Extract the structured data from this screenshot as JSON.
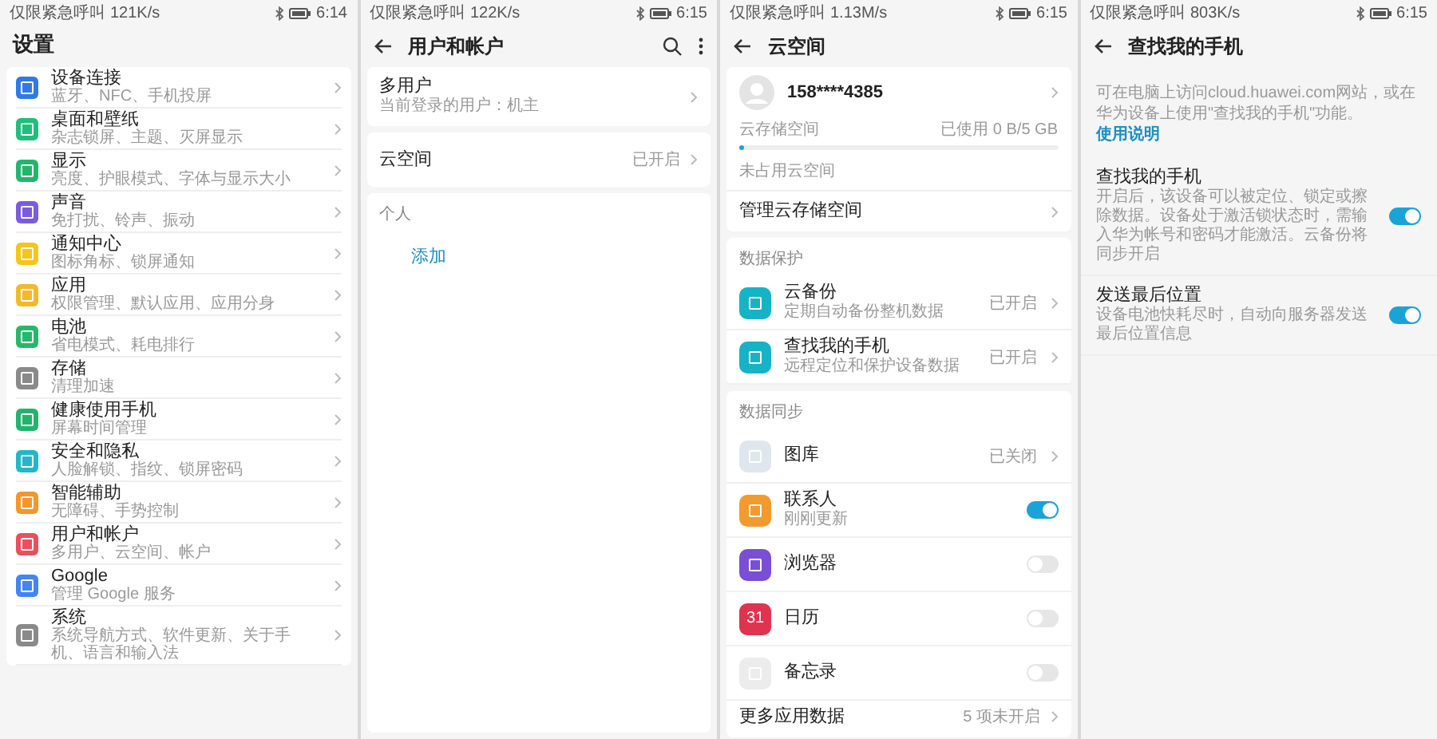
{
  "settings": {
    "status_bar": {
      "carrier": "仅限紧急呼叫",
      "speed": "121K/s",
      "time": "6:14"
    },
    "title": "设置",
    "items": [
      {
        "title": "设备连接",
        "subtitle": "蓝牙、NFC、手机投屏",
        "color": "#2f7be5"
      },
      {
        "title": "桌面和壁纸",
        "subtitle": "杂志锁屏、主题、灭屏显示",
        "color": "#1fbf7a"
      },
      {
        "title": "显示",
        "subtitle": "亮度、护眼模式、字体与显示大小",
        "color": "#22b66a"
      },
      {
        "title": "声音",
        "subtitle": "免打扰、铃声、振动",
        "color": "#7a5be0"
      },
      {
        "title": "通知中心",
        "subtitle": "图标角标、锁屏通知",
        "color": "#f5c518"
      },
      {
        "title": "应用",
        "subtitle": "权限管理、默认应用、应用分身",
        "color": "#f2b92a"
      },
      {
        "title": "电池",
        "subtitle": "省电模式、耗电排行",
        "color": "#26b86a"
      },
      {
        "title": "存储",
        "subtitle": "清理加速",
        "color": "#8a8a8a"
      },
      {
        "title": "健康使用手机",
        "subtitle": "屏幕时间管理",
        "color": "#22b46b"
      },
      {
        "title": "安全和隐私",
        "subtitle": "人脸解锁、指纹、锁屏密码",
        "color": "#20b8c8"
      },
      {
        "title": "智能辅助",
        "subtitle": "无障碍、手势控制",
        "color": "#f5962a"
      },
      {
        "title": "用户和帐户",
        "subtitle": "多用户、云空间、帐户",
        "color": "#e9505a"
      },
      {
        "title": "Google",
        "subtitle": "管理 Google 服务",
        "color": "#4285f4"
      },
      {
        "title": "系统",
        "subtitle": "系统导航方式、软件更新、关于手机、语言和输入法",
        "color": "#8a8a8a"
      }
    ]
  },
  "accounts": {
    "status_bar": {
      "carrier": "仅限紧急呼叫",
      "speed": "122K/s",
      "time": "6:15"
    },
    "title": "用户和帐户",
    "multi_user": {
      "title": "多用户",
      "subtitle": "当前登录的用户：机主"
    },
    "cloud": {
      "title": "云空间",
      "status": "已开启"
    },
    "section": "个人",
    "add_link": "添加"
  },
  "cloud": {
    "status_bar": {
      "carrier": "仅限紧急呼叫",
      "speed": "1.13M/s",
      "time": "6:15"
    },
    "title": "云空间",
    "account": "158****4385",
    "storage": {
      "label": "云存储空间",
      "usage": "已使用 0 B/5 GB",
      "level": 0,
      "free_label": "未占用云空间"
    },
    "manage": "管理云存储空间",
    "protection": {
      "heading": "数据保护",
      "items": [
        {
          "title": "云备份",
          "subtitle": "定期自动备份整机数据",
          "status": "已开启",
          "color": "#16b3c7"
        },
        {
          "title": "查找我的手机",
          "subtitle": "远程定位和保护设备数据",
          "status": "已开启",
          "color": "#16b3c7"
        }
      ]
    },
    "sync": {
      "heading": "数据同步",
      "items": [
        {
          "kind": "status",
          "title": "图库",
          "status": "已关闭",
          "color": "#dfe6ee"
        },
        {
          "kind": "toggle",
          "title": "联系人",
          "subtitle": "刚刚更新",
          "on": true,
          "color": "#f39a2e"
        },
        {
          "kind": "toggle",
          "title": "浏览器",
          "on": false,
          "color": "#7a4fd6"
        },
        {
          "kind": "toggle",
          "title": "日历",
          "on": false,
          "color": "#e0334f",
          "icon_text": "31"
        },
        {
          "kind": "toggle",
          "title": "备忘录",
          "on": false,
          "color": "#ececec"
        }
      ]
    },
    "more": {
      "title": "更多应用数据",
      "status": "5 项未开启"
    }
  },
  "find_phone": {
    "status_bar": {
      "carrier": "仅限紧急呼叫",
      "speed": "803K/s",
      "time": "6:15"
    },
    "title": "查找我的手机",
    "intro": "可在电脑上访问cloud.huawei.com网站，或在华为设备上使用\"查找我的手机\"功能。",
    "intro_link": "使用说明",
    "items": [
      {
        "title": "查找我的手机",
        "subtitle": "开启后，该设备可以被定位、锁定或擦除数据。设备处于激活锁状态时，需输入华为帐号和密码才能激活。云备份将同步开启",
        "on": true
      },
      {
        "title": "发送最后位置",
        "subtitle": "设备电池快耗尽时，自动向服务器发送最后位置信息",
        "on": true
      }
    ]
  }
}
